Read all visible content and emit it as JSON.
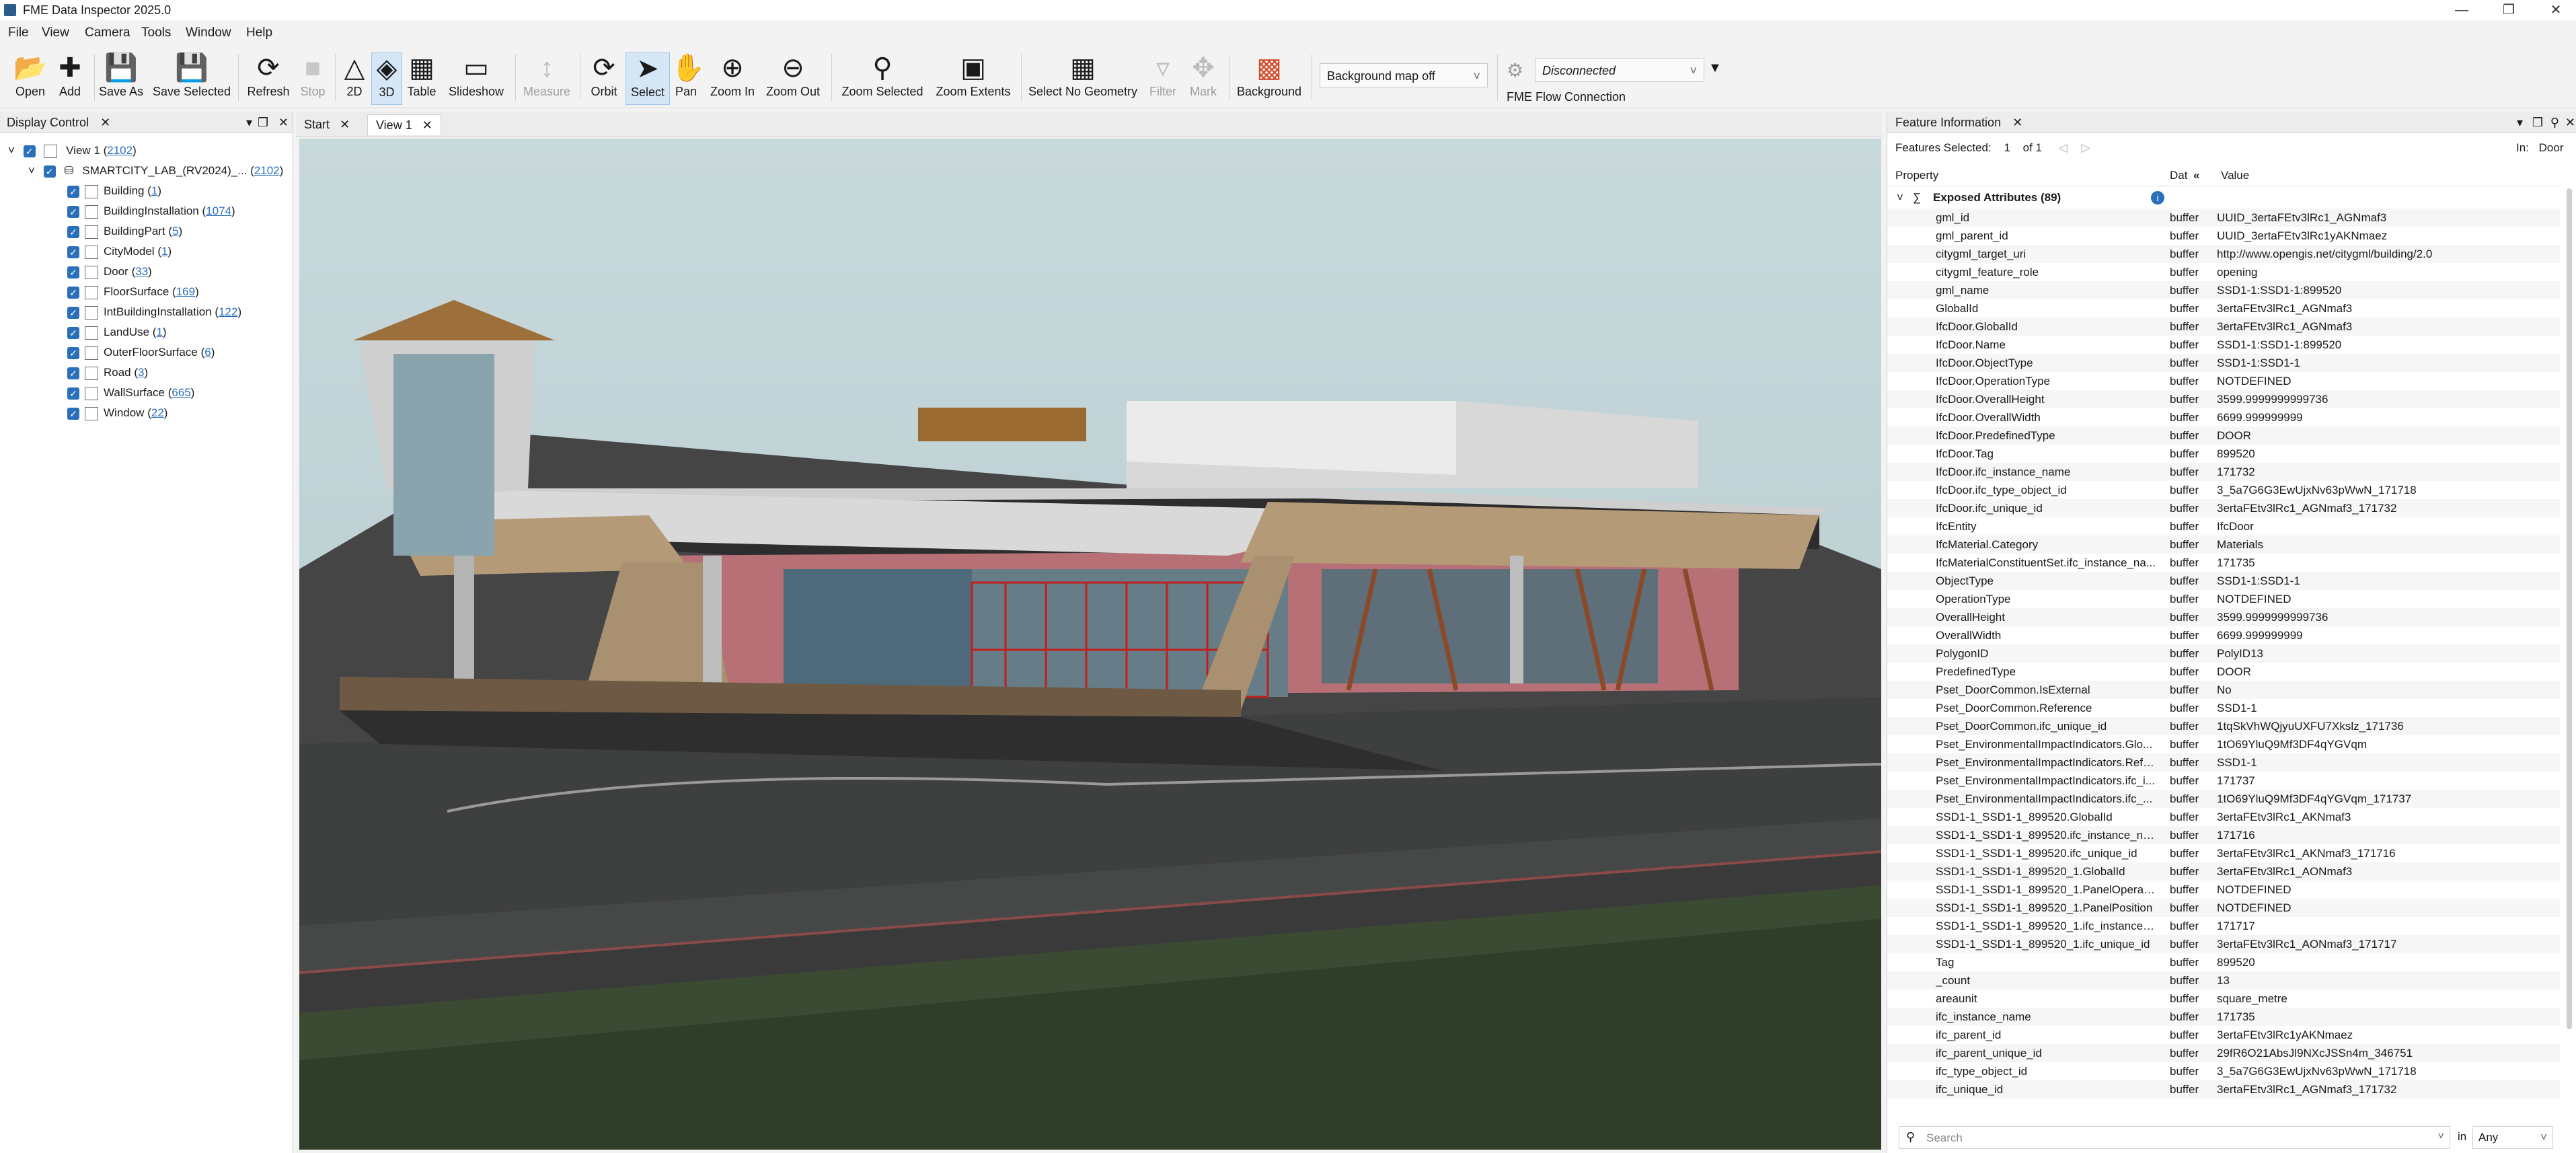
{
  "app": {
    "title": "FME Data Inspector 2025.0"
  },
  "menu": [
    "File",
    "View",
    "Camera",
    "Tools",
    "Window",
    "Help"
  ],
  "toolbar": {
    "open": "Open",
    "add": "Add",
    "save_as": "Save As",
    "save_selected": "Save Selected",
    "refresh": "Refresh",
    "stop": "Stop",
    "two_d": "2D",
    "three_d": "3D",
    "table": "Table",
    "slideshow": "Slideshow",
    "measure": "Measure",
    "orbit": "Orbit",
    "select": "Select",
    "pan": "Pan",
    "zoom_in": "Zoom In",
    "zoom_out": "Zoom Out",
    "zoom_selected": "Zoom Selected",
    "zoom_extents": "Zoom Extents",
    "select_no_geometry": "Select No Geometry",
    "filter": "Filter",
    "mark": "Mark",
    "background": "Background",
    "background_map": "Background map off",
    "connection_status": "Disconnected",
    "flow_connection": "FME Flow Connection"
  },
  "display_control": {
    "title": "Display Control",
    "view": {
      "label": "View 1",
      "count": "2102"
    },
    "dataset": {
      "label": "SMARTCITY_LAB_(RV2024)_...",
      "count": "2102"
    },
    "items": [
      {
        "label": "Building",
        "count": "1"
      },
      {
        "label": "BuildingInstallation",
        "count": "1074"
      },
      {
        "label": "BuildingPart",
        "count": "5"
      },
      {
        "label": "CityModel",
        "count": "1"
      },
      {
        "label": "Door",
        "count": "33"
      },
      {
        "label": "FloorSurface",
        "count": "169"
      },
      {
        "label": "IntBuildingInstallation",
        "count": "122"
      },
      {
        "label": "LandUse",
        "count": "1"
      },
      {
        "label": "OuterFloorSurface",
        "count": "6"
      },
      {
        "label": "Road",
        "count": "3"
      },
      {
        "label": "WallSurface",
        "count": "665"
      },
      {
        "label": "Window",
        "count": "22"
      }
    ]
  },
  "tabs": [
    "Start",
    "View 1"
  ],
  "feature_info": {
    "title": "Feature Information",
    "features_selected_label": "Features Selected:",
    "selected": "1",
    "of": "of 1",
    "in_label": "In:",
    "in_value": "Door",
    "col_property": "Property",
    "col_type": "Dat",
    "col_value": "Value",
    "group": "Exposed Attributes (89)",
    "rows": [
      [
        "gml_id",
        "buffer",
        "UUID_3ertaFEtv3lRc1_AGNmaf3"
      ],
      [
        "gml_parent_id",
        "buffer",
        "UUID_3ertaFEtv3lRc1yAKNmaez"
      ],
      [
        "citygml_target_uri",
        "buffer",
        "http://www.opengis.net/citygml/building/2.0"
      ],
      [
        "citygml_feature_role",
        "buffer",
        "opening"
      ],
      [
        "gml_name",
        "buffer",
        "SSD1-1:SSD1-1:899520"
      ],
      [
        "GlobalId",
        "buffer",
        "3ertaFEtv3lRc1_AGNmaf3"
      ],
      [
        "IfcDoor.GlobalId",
        "buffer",
        "3ertaFEtv3lRc1_AGNmaf3"
      ],
      [
        "IfcDoor.Name",
        "buffer",
        "SSD1-1:SSD1-1:899520"
      ],
      [
        "IfcDoor.ObjectType",
        "buffer",
        "SSD1-1:SSD1-1"
      ],
      [
        "IfcDoor.OperationType",
        "buffer",
        "NOTDEFINED"
      ],
      [
        "IfcDoor.OverallHeight",
        "buffer",
        "3599.9999999999736"
      ],
      [
        "IfcDoor.OverallWidth",
        "buffer",
        "6699.999999999"
      ],
      [
        "IfcDoor.PredefinedType",
        "buffer",
        "DOOR"
      ],
      [
        "IfcDoor.Tag",
        "buffer",
        "899520"
      ],
      [
        "IfcDoor.ifc_instance_name",
        "buffer",
        "171732"
      ],
      [
        "IfcDoor.ifc_type_object_id",
        "buffer",
        "3_5a7G6G3EwUjxNv63pWwN_171718"
      ],
      [
        "IfcDoor.ifc_unique_id",
        "buffer",
        "3ertaFEtv3lRc1_AGNmaf3_171732"
      ],
      [
        "IfcEntity",
        "buffer",
        "IfcDoor"
      ],
      [
        "IfcMaterial.Category",
        "buffer",
        "Materials"
      ],
      [
        "IfcMaterialConstituentSet.ifc_instance_na...",
        "buffer",
        "171735"
      ],
      [
        "ObjectType",
        "buffer",
        "SSD1-1:SSD1-1"
      ],
      [
        "OperationType",
        "buffer",
        "NOTDEFINED"
      ],
      [
        "OverallHeight",
        "buffer",
        "3599.9999999999736"
      ],
      [
        "OverallWidth",
        "buffer",
        "6699.999999999"
      ],
      [
        "PolygonID",
        "buffer",
        "PolyID13"
      ],
      [
        "PredefinedType",
        "buffer",
        "DOOR"
      ],
      [
        "Pset_DoorCommon.IsExternal",
        "buffer",
        "No"
      ],
      [
        "Pset_DoorCommon.Reference",
        "buffer",
        "SSD1-1"
      ],
      [
        "Pset_DoorCommon.ifc_unique_id",
        "buffer",
        "1tqSkVhWQjyuUXFU7Xkslz_171736"
      ],
      [
        "Pset_EnvironmentalImpactIndicators.Glo...",
        "buffer",
        "1tO69YluQ9Mf3DF4qYGVqm"
      ],
      [
        "Pset_EnvironmentalImpactIndicators.Refe...",
        "buffer",
        "SSD1-1"
      ],
      [
        "Pset_EnvironmentalImpactIndicators.ifc_i...",
        "buffer",
        "171737"
      ],
      [
        "Pset_EnvironmentalImpactIndicators.ifc_...",
        "buffer",
        "1tO69YluQ9Mf3DF4qYGVqm_171737"
      ],
      [
        "SSD1-1_SSD1-1_899520.GlobalId",
        "buffer",
        "3ertaFEtv3lRc1_AKNmaf3"
      ],
      [
        "SSD1-1_SSD1-1_899520.ifc_instance_name",
        "buffer",
        "171716"
      ],
      [
        "SSD1-1_SSD1-1_899520.ifc_unique_id",
        "buffer",
        "3ertaFEtv3lRc1_AKNmaf3_171716"
      ],
      [
        "SSD1-1_SSD1-1_899520_1.GlobalId",
        "buffer",
        "3ertaFEtv3lRc1_AONmaf3"
      ],
      [
        "SSD1-1_SSD1-1_899520_1.PanelOperation",
        "buffer",
        "NOTDEFINED"
      ],
      [
        "SSD1-1_SSD1-1_899520_1.PanelPosition",
        "buffer",
        "NOTDEFINED"
      ],
      [
        "SSD1-1_SSD1-1_899520_1.ifc_instance_n...",
        "buffer",
        "171717"
      ],
      [
        "SSD1-1_SSD1-1_899520_1.ifc_unique_id",
        "buffer",
        "3ertaFEtv3lRc1_AONmaf3_171717"
      ],
      [
        "Tag",
        "buffer",
        "899520"
      ],
      [
        "_count",
        "buffer",
        "13"
      ],
      [
        "areaunit",
        "buffer",
        "square_metre"
      ],
      [
        "ifc_instance_name",
        "buffer",
        "171735"
      ],
      [
        "ifc_parent_id",
        "buffer",
        "3ertaFEtv3lRc1yAKNmaez"
      ],
      [
        "ifc_parent_unique_id",
        "buffer",
        "29fR6O21AbsJl9NXcJSSn4m_346751"
      ],
      [
        "ifc_type_object_id",
        "buffer",
        "3_5a7G6G3EwUjxNv63pWwN_171718"
      ],
      [
        "ifc_unique_id",
        "buffer",
        "3ertaFEtv3lRc1_AGNmaf3_171732"
      ]
    ],
    "search_placeholder": "Search",
    "search_in": "in",
    "search_scope": "Any"
  }
}
